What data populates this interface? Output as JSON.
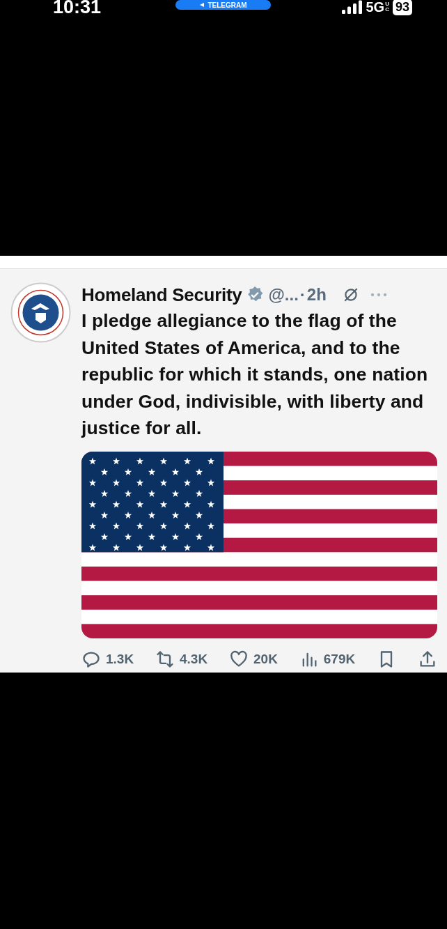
{
  "status_bar": {
    "time": "10:31",
    "back_pill": "TELEGRAM",
    "network": "5G",
    "network_sub": [
      "U",
      "C"
    ],
    "battery": "93"
  },
  "tweet": {
    "author": "Homeland Security",
    "verified": true,
    "handle": "@...",
    "separator": "·",
    "time": "2h",
    "text": "I pledge allegiance to the flag of the United States of America, and to the republic for which it stands, one nation under God, indivisible, with liberty and justice for all.",
    "actions": [
      {
        "kind": "reply",
        "count": "1.3K"
      },
      {
        "kind": "repost",
        "count": "4.3K"
      },
      {
        "kind": "like",
        "count": "20K"
      },
      {
        "kind": "views",
        "count": "679K"
      },
      {
        "kind": "bookmark"
      },
      {
        "kind": "share"
      }
    ]
  }
}
